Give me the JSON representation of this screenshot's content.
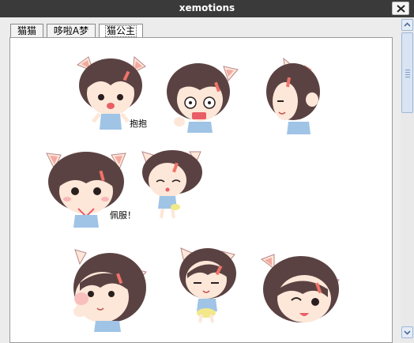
{
  "window": {
    "title": "xemotions"
  },
  "tabs": [
    {
      "label": "猫猫",
      "active": false
    },
    {
      "label": "哆啦A梦",
      "active": false
    },
    {
      "label": "猫公主",
      "active": true
    }
  ],
  "emoticons": [
    {
      "name": "hug",
      "caption": "抱抱"
    },
    {
      "name": "shocked",
      "caption": ""
    },
    {
      "name": "shy-salute",
      "caption": ""
    },
    {
      "name": "admire",
      "caption": "佩服！"
    },
    {
      "name": "bye-wave",
      "caption": ""
    },
    {
      "name": "cheek-pout",
      "caption": ""
    },
    {
      "name": "sleepy",
      "caption": ""
    },
    {
      "name": "wink",
      "caption": ""
    }
  ],
  "colors": {
    "titlebar": "#3a3a3a",
    "hair": "#5b4242",
    "skin": "#fde7d8",
    "ear_inner": "#f3a9a0",
    "dress": "#9fc4e6",
    "hairclip": "#f0736a"
  }
}
